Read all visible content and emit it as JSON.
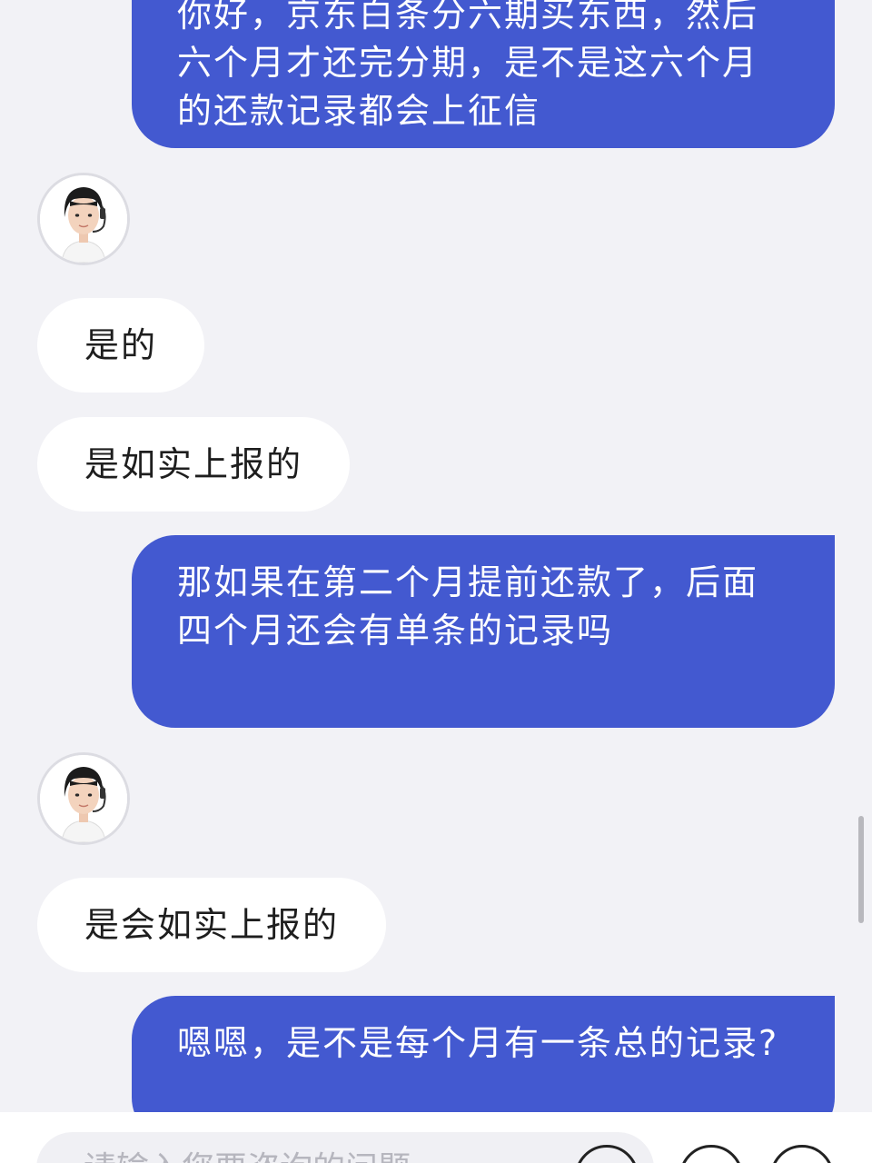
{
  "messages": [
    {
      "id": "m1",
      "role": "user",
      "text": "你好，京东白条分六期买东西，然后六个月才还完分期，是不是这六个月的还款记录都会上征信"
    },
    {
      "id": "m2",
      "role": "agent",
      "text": "是的"
    },
    {
      "id": "m3",
      "role": "agent",
      "text": "是如实上报的"
    },
    {
      "id": "m4",
      "role": "user",
      "text": "那如果在第二个月提前还款了，后面四个月还会有单条的记录吗"
    },
    {
      "id": "m5",
      "role": "agent",
      "text": "是会如实上报的"
    },
    {
      "id": "m6",
      "role": "user",
      "text": "嗯嗯，是不是每个月有一条总的记录?"
    }
  ],
  "composer": {
    "placeholder": "请输入您要咨询的问题",
    "buttons": [
      "voice-button",
      "emoji-button",
      "more-button"
    ]
  },
  "colors": {
    "background": "#f2f2f6",
    "user_bubble": "#4359d0",
    "agent_bubble": "#ffffff"
  }
}
